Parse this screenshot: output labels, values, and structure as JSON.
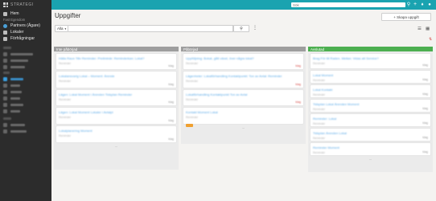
{
  "sidebar": {
    "logo_text": "STRATEGI",
    "items": [
      {
        "label": "Hem",
        "icon": "home-icon"
      },
      {
        "section": "Fast Egendom"
      },
      {
        "label": "Partners (Ägare)",
        "icon": "cloud-icon"
      },
      {
        "label": "Lokaler",
        "icon": "building-icon"
      },
      {
        "label": "Förfrågningar",
        "icon": "inquiry-icon"
      }
    ]
  },
  "topbar": {
    "search_placeholder": "Sök"
  },
  "page": {
    "title": "Uppgifter",
    "create_button": "+ Skapa uppgift"
  },
  "filter": {
    "dropdown_value": "Alla"
  },
  "columns": [
    {
      "title": "Inte påbörjad",
      "color": "#9e9e9e",
      "cards": [
        {
          "title": "Hälla Raun Tillv Reminder: Preliminär: Reminderkan: Lokal?",
          "sub": "Reminder",
          "date": "Idag",
          "date_red": false,
          "tag": false
        },
        {
          "title": "Lokalansvarig Lokal – Moment: Ärende",
          "sub": "Reminder",
          "date": "Idag",
          "date_red": false,
          "tag": false
        },
        {
          "title": "Lägen: Lokal Moment i Ärenden Tidsplan Reminder",
          "sub": "Reminder",
          "date": "Idag",
          "date_red": false,
          "tag": false
        },
        {
          "title": "Lägen: Lokal Moment Lokaler i Avtalpl",
          "sub": "Reminder",
          "date": "Idag",
          "date_red": false,
          "tag": false
        },
        {
          "title": "Lokalplanering Moment",
          "sub": "Reminder",
          "date": "Idag",
          "date_red": false,
          "tag": false
        }
      ]
    },
    {
      "title": "Påbörjad",
      "color": "#9e9e9e",
      "cards": [
        {
          "title": "Uppföljning: Bokat, gått växel, över några lokal?",
          "sub": "Reminder",
          "date": "Idag",
          "date_red": true,
          "tag": false
        },
        {
          "title": "Lägenheter: Lokalförhandling Kontaktpunkt: Ton av Avtal: Reminder",
          "sub": "Reminder",
          "date": "Idag",
          "date_red": true,
          "tag": false
        },
        {
          "title": "Lokalförhandling Kontaktpunkt Ton av Avtal",
          "sub": "Reminder",
          "date": "Idag",
          "date_red": true,
          "tag": false
        },
        {
          "title": "Kontakt Moment Lokal",
          "sub": "Reminder",
          "date": "",
          "date_red": false,
          "tag": false
        },
        {
          "title": "Förhandling Lokal",
          "sub": "",
          "date": "",
          "date_red": false,
          "tag": true
        }
      ]
    },
    {
      "title": "Avslutad",
      "color": "#4caf50",
      "cards": [
        {
          "title": "Brag För till Raden. Mellan: Vidas att Service?",
          "sub": "Reminder",
          "date": "Idag",
          "date_red": false,
          "tag": false
        },
        {
          "title": "Lokal Moment",
          "sub": "Reminder",
          "date": "Idag",
          "date_red": false,
          "tag": false
        },
        {
          "title": "Lokal Kontakt",
          "sub": "Reminder",
          "date": "Idag",
          "date_red": false,
          "tag": false
        },
        {
          "title": "Tidsplan Lokal Ärenden Moment",
          "sub": "Reminder",
          "date": "Idag",
          "date_red": false,
          "tag": false
        },
        {
          "title": "Reminder: Lokal",
          "sub": "Reminder",
          "date": "Idag",
          "date_red": false,
          "tag": false
        },
        {
          "title": "Tidsplan Ärenden Lokal",
          "sub": "Reminder",
          "date": "Idag",
          "date_red": false,
          "tag": false
        },
        {
          "title": "Reminder Moment",
          "sub": "Reminder",
          "date": "Idag",
          "date_red": false,
          "tag": false
        }
      ]
    }
  ]
}
